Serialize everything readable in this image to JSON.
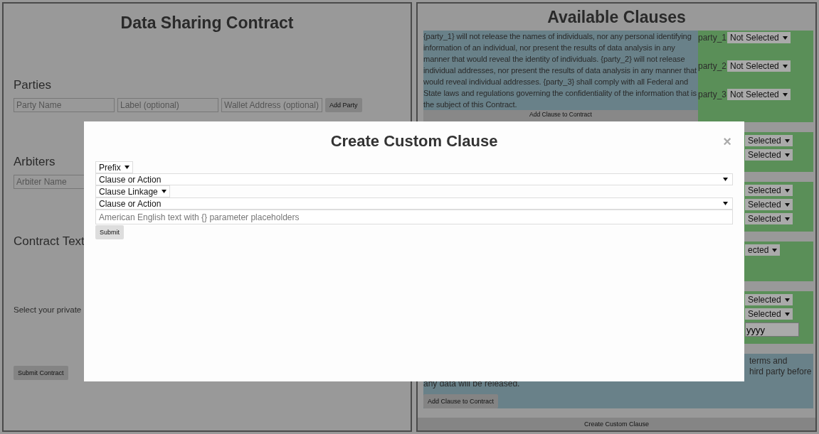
{
  "contract": {
    "title": "Data Sharing Contract",
    "parties": {
      "heading": "Parties",
      "fields": [
        {
          "placeholder": "Party Name"
        },
        {
          "placeholder": "Label (optional)"
        },
        {
          "placeholder": "Wallet Address (optional)"
        }
      ],
      "button": "Add Party"
    },
    "arbiters": {
      "heading": "Arbiters",
      "field": {
        "placeholder": "Arbiter Name"
      }
    },
    "contract_text": {
      "heading": "Contract Text"
    },
    "key_prompt": "Select your private",
    "submit_button": "Submit Contract"
  },
  "clauses": {
    "title": "Available Clauses",
    "items": [
      {
        "kind": "standard",
        "text": "{party_1} will not release the names of individuals, nor any personal identifying information of an individual, nor present the results of data analysis in any manner that would reveal the identity of individuals. {party_2} will not release individual addresses, nor present the results of data analysis in any manner that would reveal individual addresses. {party_3} shall comply with all Federal and State laws and regulations governing the confidentiality of the information that is the subject of this Contract.",
        "add_button": "Add Clause to Contract",
        "params": [
          {
            "label": "party_1",
            "value": "Not Selected"
          },
          {
            "label": "party_2",
            "value": "Not Selected"
          },
          {
            "label": "party_3",
            "value": "Not Selected"
          }
        ]
      },
      {
        "kind": "standard",
        "params": [
          {
            "value": "Selected"
          },
          {
            "value": "Selected"
          }
        ]
      },
      {
        "kind": "standard",
        "params": [
          {
            "value": "Selected"
          },
          {
            "value": "Selected"
          },
          {
            "value": "Selected"
          }
        ]
      },
      {
        "kind": "standard",
        "params": [
          {
            "value": "ected"
          }
        ]
      },
      {
        "kind": "standard",
        "params": [
          {
            "value": "Selected"
          },
          {
            "value": "Selected"
          }
        ],
        "inputs": [
          {
            "value": "yyyy"
          }
        ]
      },
      {
        "kind": "plain",
        "text_parts": [
          "terms and",
          "hird party before",
          "any data will be released."
        ],
        "add_button": "Add Clause to Contract"
      }
    ],
    "create_button": "Create Custom Clause"
  },
  "modal": {
    "title": "Create Custom Clause",
    "close": "×",
    "controls": [
      {
        "kind": "short-select",
        "value": "Prefix"
      },
      {
        "kind": "wide-select",
        "value": "Clause or Action"
      },
      {
        "kind": "short-select",
        "value": "Clause Linkage"
      },
      {
        "kind": "wide-select",
        "value": "Clause or Action"
      },
      {
        "kind": "text-input",
        "placeholder": "American English text with {} parameter placeholders"
      }
    ],
    "submit": "Submit"
  }
}
